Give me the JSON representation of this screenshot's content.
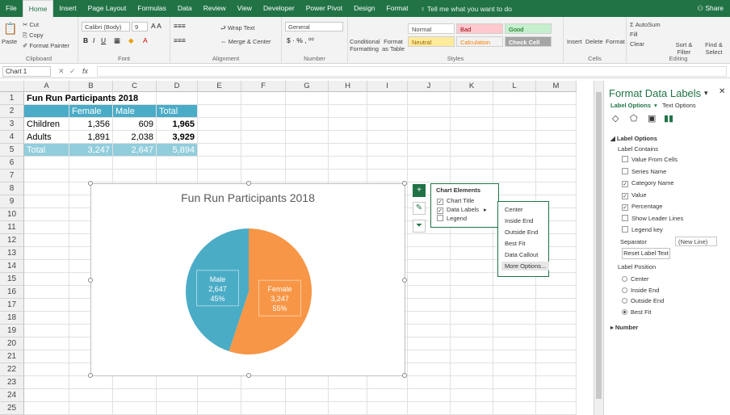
{
  "tabs": [
    "File",
    "Home",
    "Insert",
    "Page Layout",
    "Formulas",
    "Data",
    "Review",
    "View",
    "Developer",
    "Power Pivot",
    "Design",
    "Format"
  ],
  "tell_me": "Tell me what you want to do",
  "share": "Share",
  "ribbon": {
    "clipboard": {
      "cut": "Cut",
      "copy": "Copy",
      "paste": "Paste",
      "format_painter": "Format Painter",
      "label": "Clipboard"
    },
    "font": {
      "name": "Calibri (Body)",
      "size": "9",
      "label": "Font"
    },
    "alignment": {
      "wrap": "Wrap Text",
      "merge": "Merge & Center",
      "label": "Alignment"
    },
    "number": {
      "format": "General",
      "label": "Number"
    },
    "styles": {
      "conditional": "Conditional Formatting",
      "format_as": "Format as Table",
      "normal": "Normal",
      "bad": "Bad",
      "good": "Good",
      "neutral": "Neutral",
      "calculation": "Calculation",
      "check_cell": "Check Cell",
      "label": "Styles"
    },
    "cells": {
      "insert": "Insert",
      "delete": "Delete",
      "format": "Format",
      "label": "Cells"
    },
    "editing": {
      "autosum": "AutoSum",
      "fill": "Fill",
      "clear": "Clear",
      "sort": "Sort & Filter",
      "find": "Find & Select",
      "label": "Editing"
    }
  },
  "name_box": "Chart 1",
  "columns": [
    "A",
    "B",
    "C",
    "D",
    "E",
    "F",
    "G",
    "H",
    "I",
    "J",
    "K",
    "L",
    "M"
  ],
  "rows": [
    "1",
    "2",
    "3",
    "4",
    "5",
    "6",
    "7",
    "8",
    "9",
    "10",
    "11",
    "12",
    "13",
    "14",
    "15",
    "16",
    "17",
    "18",
    "19",
    "20",
    "21",
    "22",
    "23",
    "24",
    "25"
  ],
  "table": {
    "title": "Fun Run Participants 2018",
    "headers": [
      "",
      "Female",
      "Male",
      "Total"
    ],
    "rows": [
      [
        "Children",
        "1,356",
        "609",
        "1,965"
      ],
      [
        "Adults",
        "1,891",
        "2,038",
        "3,929"
      ]
    ],
    "total": [
      "Total",
      "3,247",
      "2,647",
      "5,894"
    ]
  },
  "chart": {
    "title": "Fun Run Participants 2018"
  },
  "chart_data": {
    "type": "pie",
    "title": "Fun Run Participants 2018",
    "categories": [
      "Female",
      "Male"
    ],
    "values": [
      3247,
      2647
    ],
    "percent_labels": [
      "55%",
      "45%"
    ],
    "colors": [
      "#f79646",
      "#4bacc6"
    ]
  },
  "chart_elements": {
    "title": "Chart Elements",
    "items": [
      {
        "label": "Chart Title",
        "checked": "✓"
      },
      {
        "label": "Data Labels",
        "checked": "✓"
      },
      {
        "label": "Legend",
        "checked": ""
      }
    ]
  },
  "label_menu": [
    "Center",
    "Inside End",
    "Outside End",
    "Best Fit",
    "Data Callout",
    "More Options..."
  ],
  "pane": {
    "title": "Format Data Labels",
    "tab1": "Label Options",
    "tab2": "Text Options",
    "section": "Label Options",
    "contains": "Label Contains",
    "checks": [
      {
        "label": "Value From Cells",
        "checked": ""
      },
      {
        "label": "Series Name",
        "checked": ""
      },
      {
        "label": "Category Name",
        "checked": "✓"
      },
      {
        "label": "Value",
        "checked": "✓"
      },
      {
        "label": "Percentage",
        "checked": "✓"
      },
      {
        "label": "Show Leader Lines",
        "checked": ""
      },
      {
        "label": "Legend key",
        "checked": ""
      }
    ],
    "separator_label": "Separator",
    "separator_value": "(New Line)",
    "reset": "Reset Label Text",
    "position_label": "Label Position",
    "positions": [
      "Center",
      "Inside End",
      "Outside End",
      "Best Fit"
    ],
    "selected_position": "Best Fit",
    "number": "Number"
  },
  "colors": {
    "excel_green": "#217346",
    "header_fill": "#4aacc6",
    "total_fill": "#92cddc",
    "female": "#f79646",
    "male": "#4bacc6"
  }
}
